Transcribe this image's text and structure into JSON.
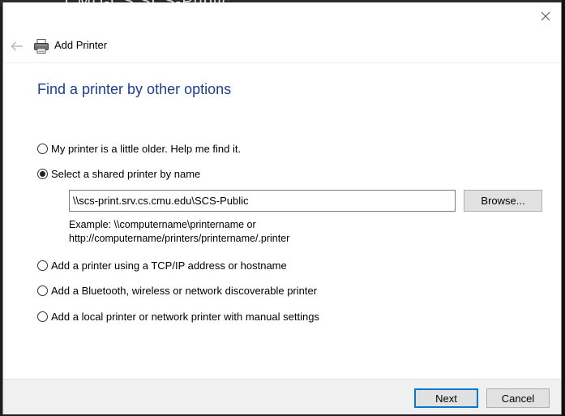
{
  "background": {
    "ghost_text": "CMU-CS SCS-Public"
  },
  "window": {
    "close_tooltip": "Close"
  },
  "nav": {
    "title": "Add Printer"
  },
  "main": {
    "heading": "Find a printer by other options",
    "options": [
      {
        "label": "My printer is a little older. Help me find it.",
        "checked": false
      },
      {
        "label": "Select a shared printer by name",
        "checked": true
      },
      {
        "label": "Add a printer using a TCP/IP address or hostname",
        "checked": false
      },
      {
        "label": "Add a Bluetooth, wireless or network discoverable printer",
        "checked": false
      },
      {
        "label": "Add a local printer or network printer with manual settings",
        "checked": false
      }
    ],
    "shared_printer_value": "\\\\scs-print.srv.cs.cmu.edu\\SCS-Public",
    "browse_label": "Browse...",
    "example_line1": "Example: \\\\computername\\printername or",
    "example_line2": "http://computername/printers/printername/.printer"
  },
  "footer": {
    "next_label": "Next",
    "cancel_label": "Cancel"
  },
  "colors": {
    "heading": "#1e3f8c",
    "focus_border": "#0078d7",
    "footer_bg": "#f0f0f0"
  }
}
